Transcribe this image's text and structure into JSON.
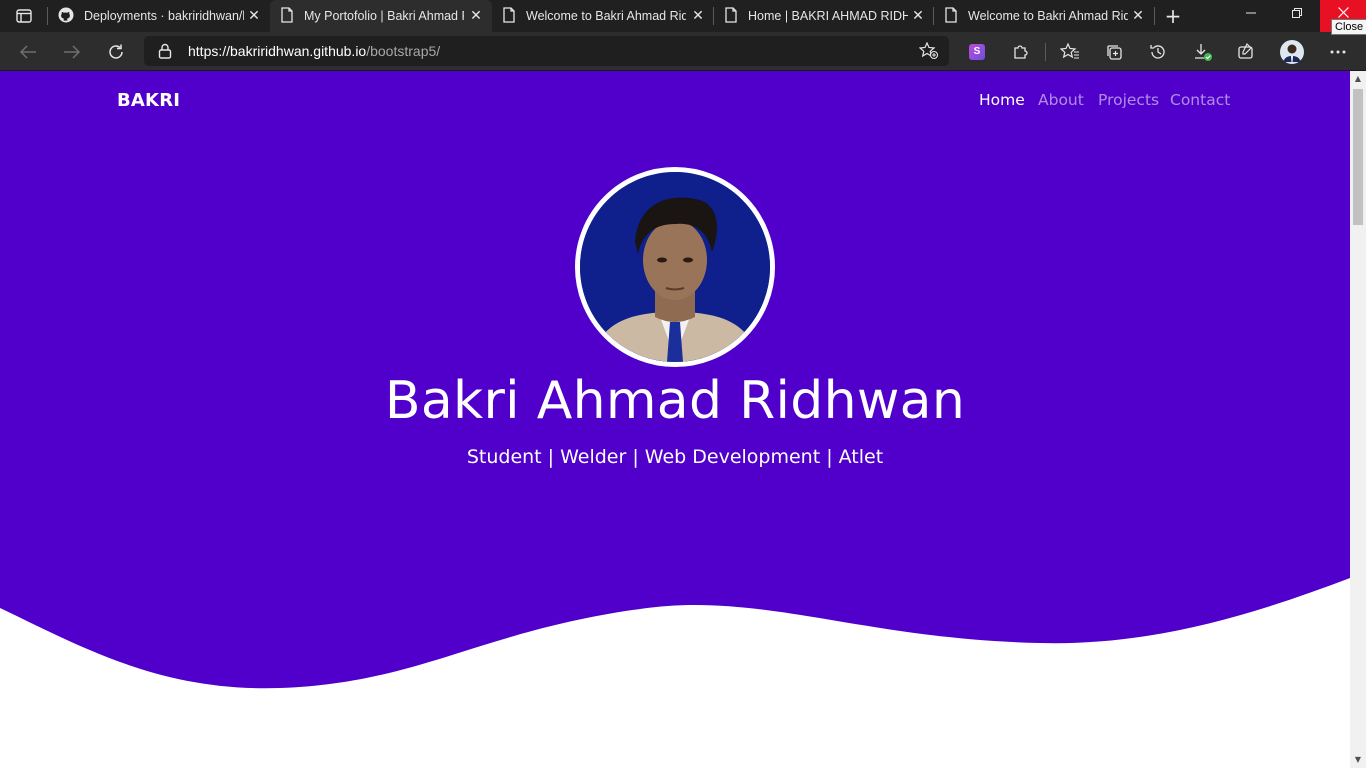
{
  "browser": {
    "tabs": [
      {
        "title": "Deployments · bakriridhwan/b",
        "icon": "github-icon",
        "active": false
      },
      {
        "title": "My Portofolio | Bakri Ahmad R",
        "icon": "page-icon",
        "active": true
      },
      {
        "title": "Welcome to Bakri Ahmad Rid",
        "icon": "page-icon",
        "active": false
      },
      {
        "title": "Home | BAKRI AHMAD RIDHW",
        "icon": "page-icon",
        "active": false
      },
      {
        "title": "Welcome to Bakri Ahmad Rid",
        "icon": "page-icon",
        "active": false
      }
    ],
    "close_tooltip": "Close",
    "url_host": "https://bakriridhwan.github.io",
    "url_path": "/bootstrap5/",
    "extension_badge": "S"
  },
  "page": {
    "brand": "BAKRI",
    "nav": [
      {
        "label": "Home",
        "active": true
      },
      {
        "label": "About",
        "active": false
      },
      {
        "label": "Projects",
        "active": false
      },
      {
        "label": "Contact",
        "active": false
      }
    ],
    "name": "Bakri Ahmad Ridhwan",
    "tagline": "Student | Welder | Web Development | Atlet"
  },
  "colors": {
    "hero_bg": "#5000ca",
    "chrome_dark": "#202020",
    "close_red": "#e81123"
  }
}
